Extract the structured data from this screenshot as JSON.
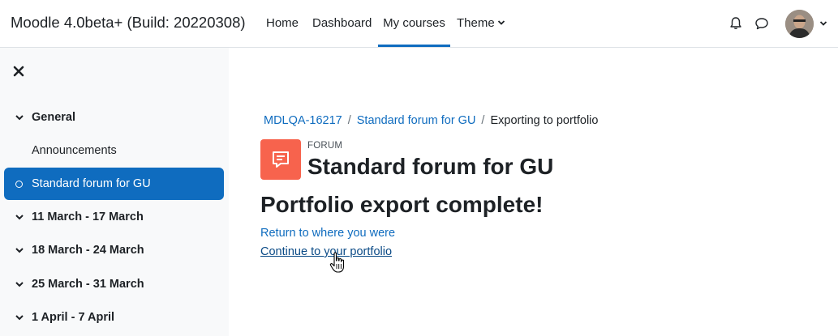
{
  "navbar": {
    "site_name": "Moodle 4.0beta+ (Build: 20220308)",
    "items": [
      {
        "label": "Home"
      },
      {
        "label": "Dashboard"
      },
      {
        "label": "My courses",
        "active": true
      },
      {
        "label": "Theme",
        "dropdown": true
      }
    ],
    "icons": [
      "bell-icon",
      "chat-icon"
    ],
    "user_menu": {
      "avatar": "user-avatar",
      "caret": "chevron-down-icon"
    }
  },
  "drawer": {
    "close_icon": "close-icon",
    "items": [
      {
        "label": "General",
        "type": "section",
        "expanded": true
      },
      {
        "label": "Announcements",
        "type": "activity"
      },
      {
        "label": "Standard forum for GU",
        "type": "activity",
        "selected": true
      },
      {
        "label": "11 March - 17 March",
        "type": "section",
        "expanded": true
      },
      {
        "label": "18 March - 24 March",
        "type": "section",
        "expanded": true
      },
      {
        "label": "25 March - 31 March",
        "type": "section",
        "expanded": true
      },
      {
        "label": "1 April - 7 April",
        "type": "section",
        "expanded": true
      }
    ]
  },
  "breadcrumb": {
    "items": [
      {
        "label": "MDLQA-16217",
        "link": true
      },
      {
        "label": "Standard forum for GU",
        "link": true
      },
      {
        "label": "Exporting to portfolio",
        "link": false
      }
    ]
  },
  "activity": {
    "type_label": "FORUM",
    "title": "Standard forum for GU",
    "icon": "forum-icon"
  },
  "content": {
    "heading": "Portfolio export complete!",
    "links": [
      {
        "label": "Return to where you were"
      },
      {
        "label": "Continue to your portfolio"
      }
    ]
  },
  "colors": {
    "primary": "#0f6cbf",
    "forum_icon_bg": "#f7634d",
    "drawer_bg": "#f8f9fa"
  }
}
